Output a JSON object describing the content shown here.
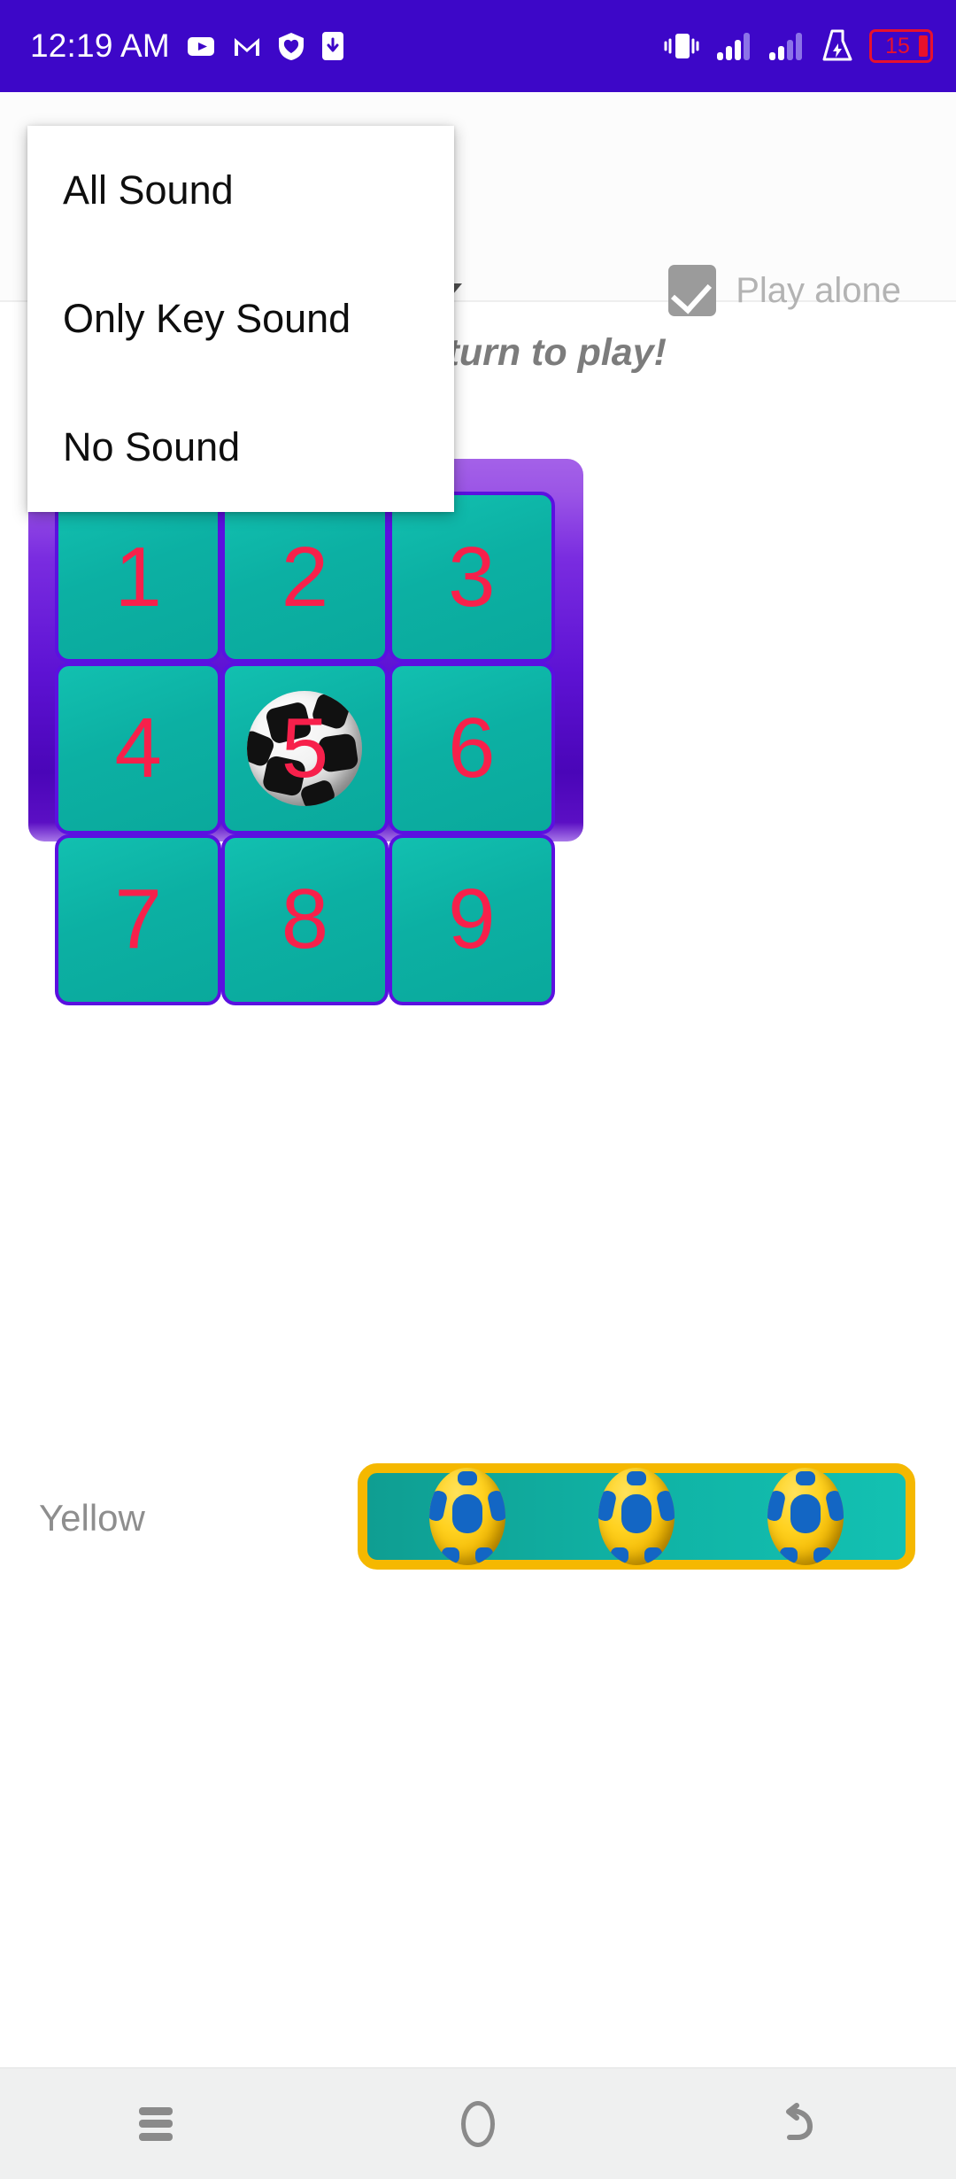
{
  "status_bar": {
    "time": "12:19 AM",
    "battery_level": "15",
    "background_color": "#3d07c8",
    "left_icons": [
      "youtube-icon",
      "gmail-icon",
      "shield-icon",
      "phone-download-icon"
    ],
    "right_icons": [
      "vibrate-icon",
      "signal-bars-icon-1",
      "signal-bars-icon-2",
      "flask-icon",
      "battery-icon"
    ]
  },
  "topbar": {
    "spinner_caret": "▼",
    "play_alone_label": "Play alone",
    "play_alone_checked": true,
    "checkbox_color": "#9b9b9b",
    "label_color": "#b3b3b3"
  },
  "dropdown": {
    "items": [
      {
        "label": "All Sound"
      },
      {
        "label": "Only Key Sound"
      },
      {
        "label": "No Sound"
      }
    ]
  },
  "turn_message": "it's your turn to play!",
  "board": {
    "background_top_color": "#a461e8",
    "background_bottom_color": "#4a05b8",
    "cell_color": "#0fb5a8",
    "cell_border_color": "#5b10e0",
    "number_color": "#f7204b",
    "cells": [
      {
        "label": "1",
        "has_ball": false
      },
      {
        "label": "2",
        "has_ball": false
      },
      {
        "label": "3",
        "has_ball": false
      },
      {
        "label": "4",
        "has_ball": false
      },
      {
        "label": "5",
        "has_ball": true
      },
      {
        "label": "6",
        "has_ball": false
      },
      {
        "label": "7",
        "has_ball": false
      },
      {
        "label": "8",
        "has_ball": false
      },
      {
        "label": "9",
        "has_ball": false
      }
    ]
  },
  "score": {
    "player_label": "Yellow",
    "ball_count": 3,
    "box_border_color": "#f5b800",
    "box_fill_color": "#10b3a5",
    "label_color": "#8e8e8e"
  },
  "navbar": {
    "buttons": [
      {
        "icon": "menu-icon"
      },
      {
        "icon": "home-icon"
      },
      {
        "icon": "back-icon"
      }
    ],
    "background_color": "#eff0f0"
  }
}
